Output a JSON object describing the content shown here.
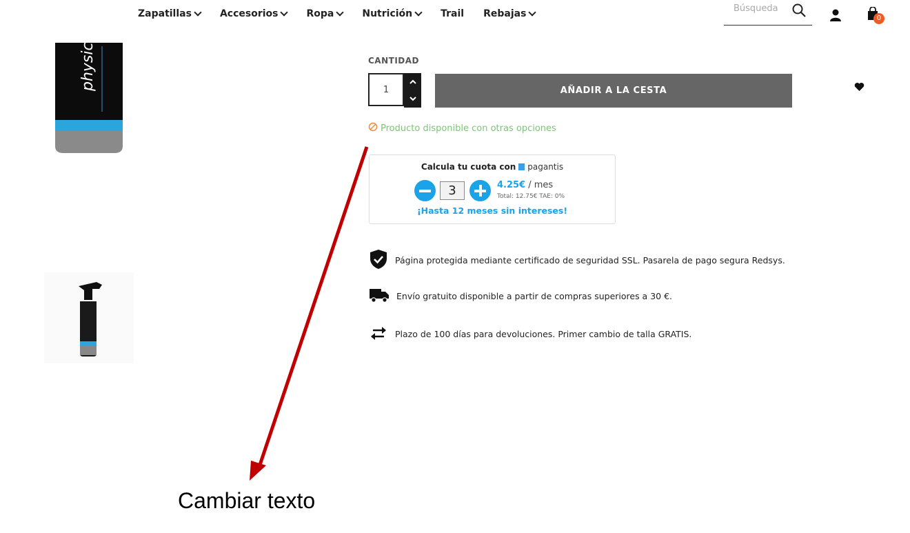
{
  "nav": {
    "items": [
      {
        "label": "Zapatillas",
        "dropdown": true
      },
      {
        "label": "Accesorios",
        "dropdown": true
      },
      {
        "label": "Ropa",
        "dropdown": true
      },
      {
        "label": "Nutrición",
        "dropdown": true
      },
      {
        "label": "Trail",
        "dropdown": false
      },
      {
        "label": "Rebajas",
        "dropdown": true
      }
    ],
    "search_placeholder": "Búsqueda",
    "cart_count": "0"
  },
  "product": {
    "quantity_label": "CANTIDAD",
    "quantity_value": "1",
    "add_to_cart_label": "AÑADIR A LA CESTA",
    "availability": "Producto disponible con otras opciones",
    "availability_color": "#7cc576"
  },
  "pagantis": {
    "title": "Calcula tu cuota con",
    "brand": "pagantis",
    "months": "3",
    "amount": "4.25€",
    "period": " / mes",
    "total": "Total: 12.75€ TAE: 0%",
    "promo": "¡Hasta 12 meses sin intereses!",
    "accent_color": "#1aa3e8"
  },
  "info": [
    {
      "icon": "shield-check-icon",
      "text": "Página protegida mediante certificado de seguridad SSL. Pasarela de pago segura Redsys."
    },
    {
      "icon": "truck-icon",
      "text": "Envío gratuito disponible a partir de compras superiores a 30 €."
    },
    {
      "icon": "exchange-arrows-icon",
      "text": "Plazo de 100 días para devoluciones. Primer cambio de talla GRATIS."
    }
  ],
  "annotation": {
    "text": "Cambiar texto",
    "arrow_color": "#c00000"
  },
  "brand_text": "physicool"
}
